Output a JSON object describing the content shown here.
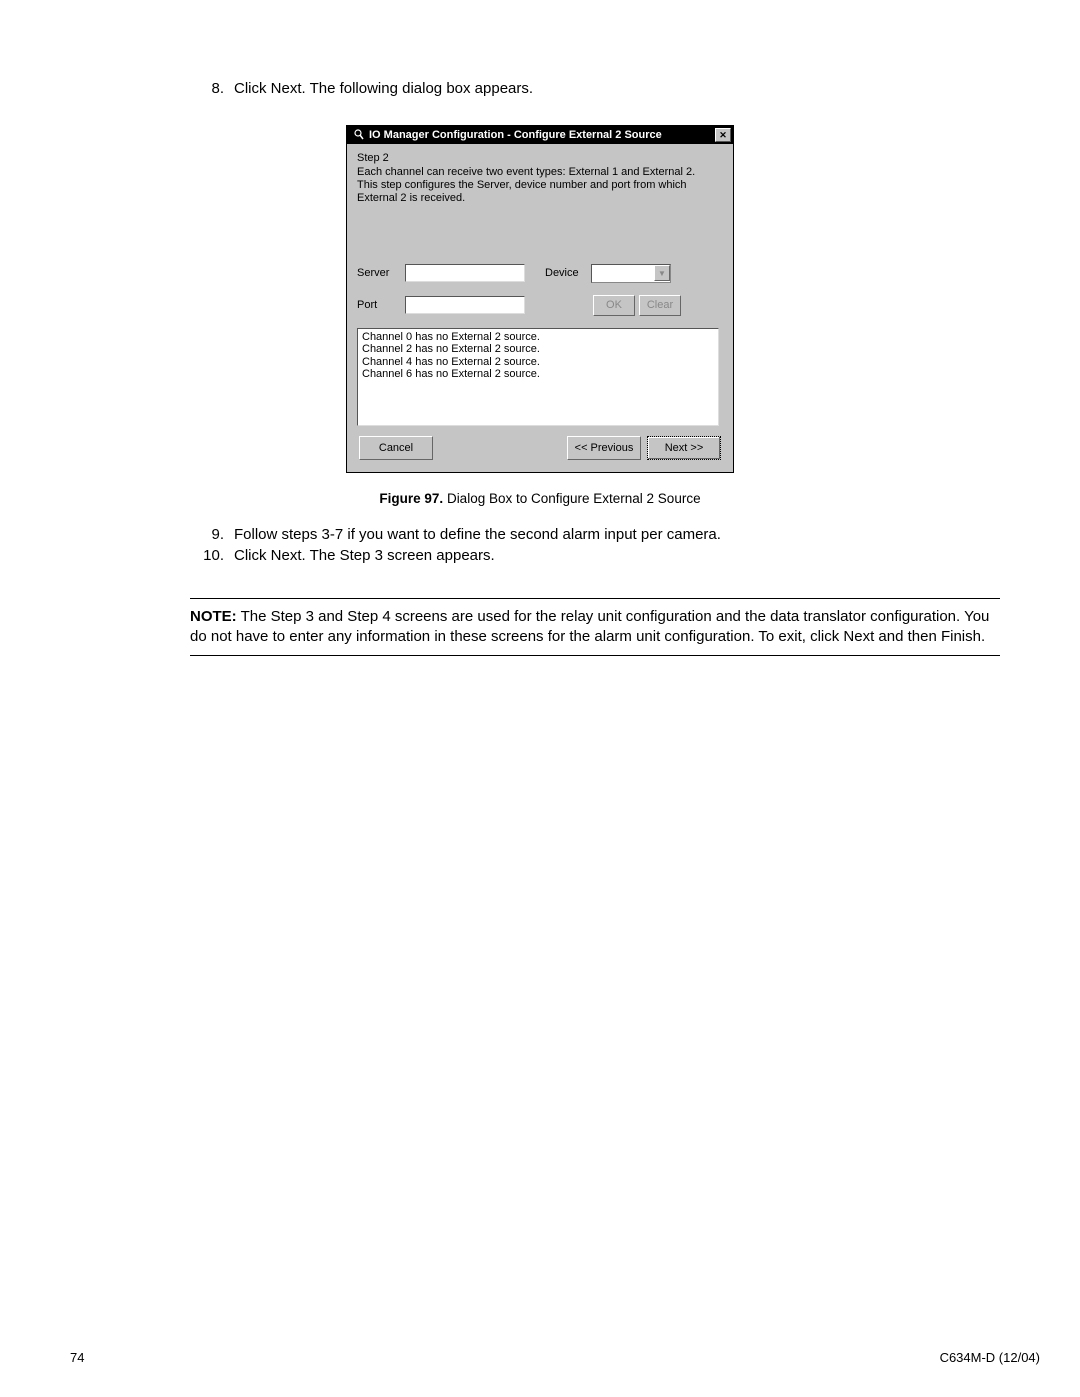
{
  "step8": {
    "num": "8.",
    "text": "Click Next. The following dialog box appears."
  },
  "dialog": {
    "title": "IO Manager Configuration - Configure External 2 Source",
    "step_head": "Step 2",
    "step_desc1": "Each channel can receive two event types: External 1 and External 2.",
    "step_desc2": "This step configures the Server, device number and port from which External 2 is received.",
    "server_label": "Server",
    "device_label": "Device",
    "port_label": "Port",
    "ok_label": "OK",
    "clear_label": "Clear",
    "status_lines": [
      "Channel 0 has no External 2 source.",
      "Channel 2 has no External 2 source.",
      "Channel 4 has no External 2 source.",
      "Channel 6 has no External 2 source."
    ],
    "cancel_label": "Cancel",
    "prev_label": "<< Previous",
    "next_label": "Next >>"
  },
  "figure_caption": {
    "bold": "Figure 97.",
    "rest": "  Dialog Box to Configure External 2 Source"
  },
  "step9": {
    "num": "9.",
    "text": "Follow steps 3-7 if you want to define the second alarm input per camera."
  },
  "step10": {
    "num": "10.",
    "text": "Click Next. The Step 3 screen appears."
  },
  "note": {
    "label": "NOTE:",
    "text": "  The Step 3 and Step 4 screens are used for the relay unit configuration and the data translator configuration. You do not have to enter any information in these screens for the alarm unit configuration. To exit, click Next and then Finish."
  },
  "footer": {
    "page_num": "74",
    "doc_id": "C634M-D (12/04)"
  }
}
